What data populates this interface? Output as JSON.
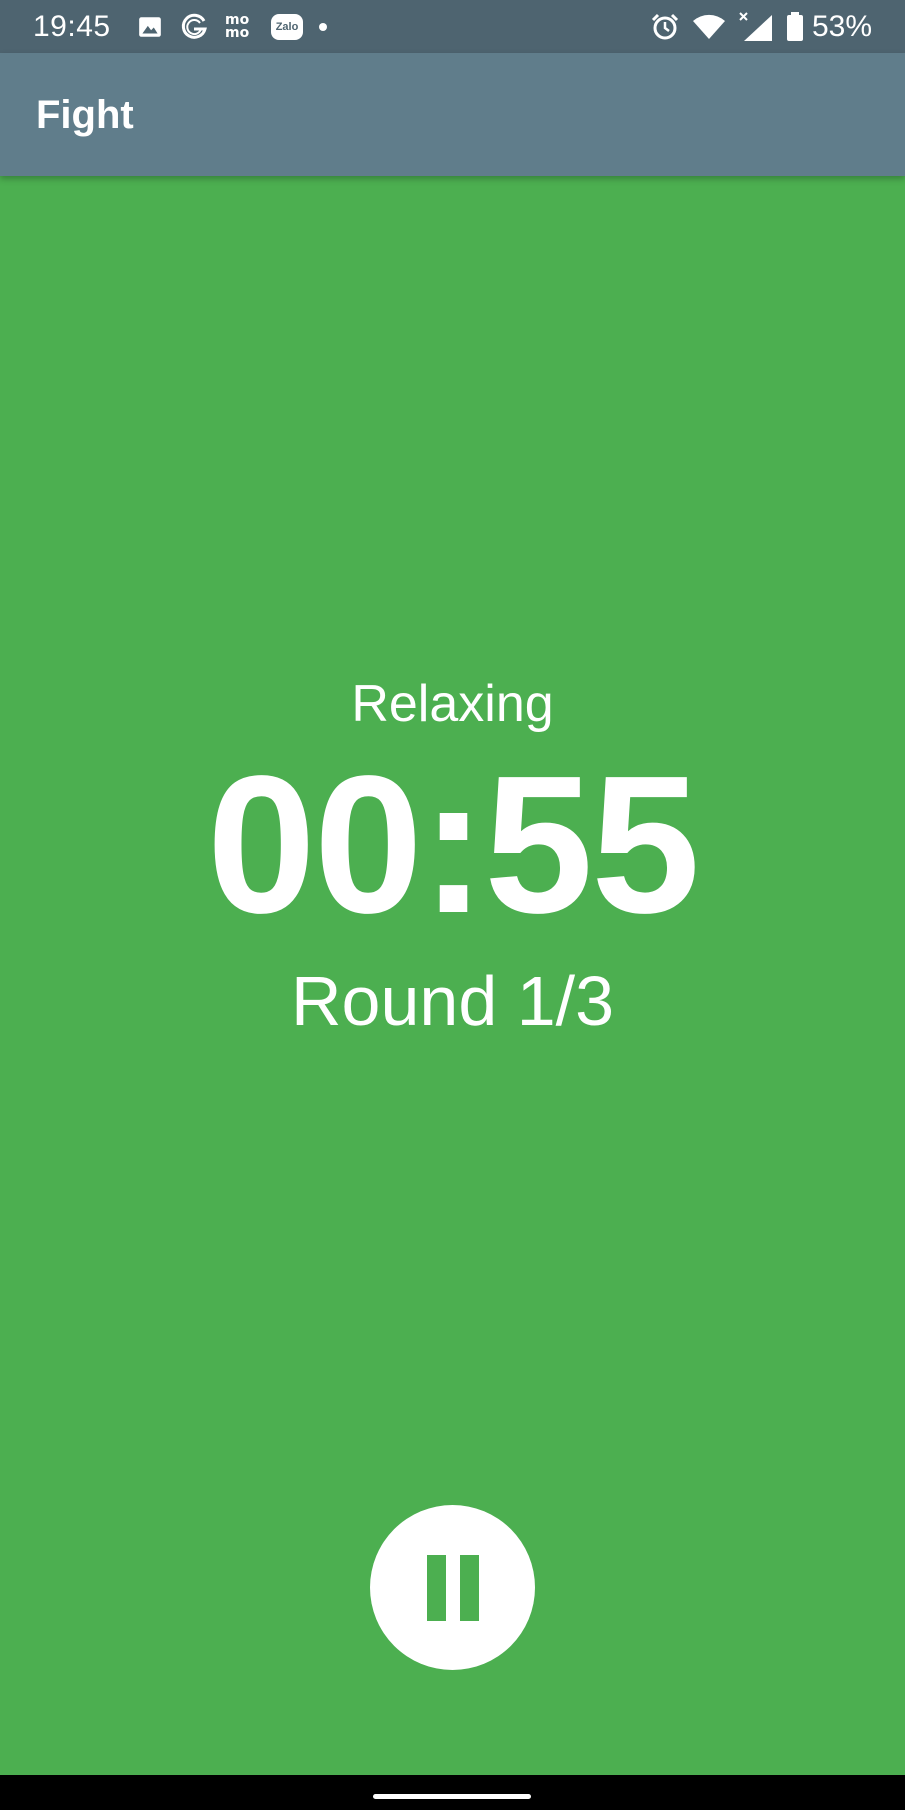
{
  "status_bar": {
    "time": "19:45",
    "left_icons": [
      "gallery-icon",
      "g-icon",
      "momo-icon",
      "zalo-icon",
      "notification-dot-icon"
    ],
    "momo_label_top": "mo",
    "momo_label_bottom": "mo",
    "zalo_label": "Zalo",
    "right_icons": [
      "alarm-icon",
      "wifi-icon",
      "signal-icon",
      "battery-icon"
    ],
    "battery_percent": "53%"
  },
  "app_bar": {
    "title": "Fight"
  },
  "timer_screen": {
    "phase": "Relaxing",
    "time_remaining": "00:55",
    "round": "Round 1/3",
    "pause_button_icon": "pause-icon"
  },
  "colors": {
    "background": "#4caf50",
    "app_bar": "#607d8b",
    "status_bar": "#4e6470",
    "text": "#ffffff"
  }
}
